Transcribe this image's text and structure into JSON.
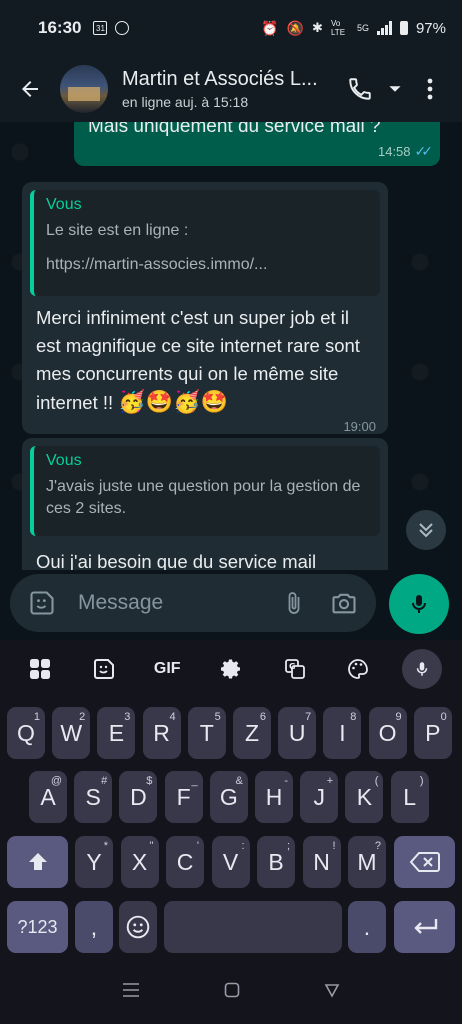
{
  "status_bar": {
    "time": "16:30",
    "icon_left_1": "31",
    "network": "Vo LTE",
    "net_gen": "5G",
    "battery": "97%"
  },
  "header": {
    "title": "Martin et Associés L...",
    "subtitle": "en ligne auj. à 15:18"
  },
  "messages": {
    "out_top": {
      "text": "Mais uniquement du service mail ?",
      "time": "14:58"
    },
    "in_1": {
      "quote_author": "Vous",
      "quote_line1": "Le site est en ligne  :",
      "quote_line2": "https://martin-associes.immo/...",
      "text": "Merci infiniment c'est un super job et il est magnifique ce site internet rare sont mes concurrents qui on le même site internet !! ",
      "emojis": [
        "🥳",
        "🤩",
        "🥳",
        "🤩"
      ],
      "time": "19:00"
    },
    "in_2": {
      "quote_author": "Vous",
      "quote_text": "J'avais juste une question pour la gestion de ces 2 sites.",
      "text": "Oui j'ai besoin que du service mail"
    }
  },
  "composer": {
    "placeholder": "Message"
  },
  "keyboard": {
    "toolbar": {
      "gif_label": "GIF"
    },
    "row1": [
      {
        "k": "Q",
        "s": "1"
      },
      {
        "k": "W",
        "s": "2"
      },
      {
        "k": "E",
        "s": "3"
      },
      {
        "k": "R",
        "s": "4"
      },
      {
        "k": "T",
        "s": "5"
      },
      {
        "k": "Z",
        "s": "6"
      },
      {
        "k": "U",
        "s": "7"
      },
      {
        "k": "I",
        "s": "8"
      },
      {
        "k": "O",
        "s": "9"
      },
      {
        "k": "P",
        "s": "0"
      }
    ],
    "row2": [
      {
        "k": "A",
        "s": "@"
      },
      {
        "k": "S",
        "s": "#"
      },
      {
        "k": "D",
        "s": "$"
      },
      {
        "k": "F",
        "s": "_"
      },
      {
        "k": "G",
        "s": "&"
      },
      {
        "k": "H",
        "s": "-"
      },
      {
        "k": "J",
        "s": "+"
      },
      {
        "k": "K",
        "s": "("
      },
      {
        "k": "L",
        "s": ")"
      }
    ],
    "row3": [
      {
        "k": "Y",
        "s": "*"
      },
      {
        "k": "X",
        "s": "\""
      },
      {
        "k": "C",
        "s": "'"
      },
      {
        "k": "V",
        "s": ":"
      },
      {
        "k": "B",
        "s": ";"
      },
      {
        "k": "N",
        "s": "!"
      },
      {
        "k": "M",
        "s": "?"
      }
    ],
    "symbols_label": "?123",
    "comma_label": ",",
    "period_label": "."
  }
}
